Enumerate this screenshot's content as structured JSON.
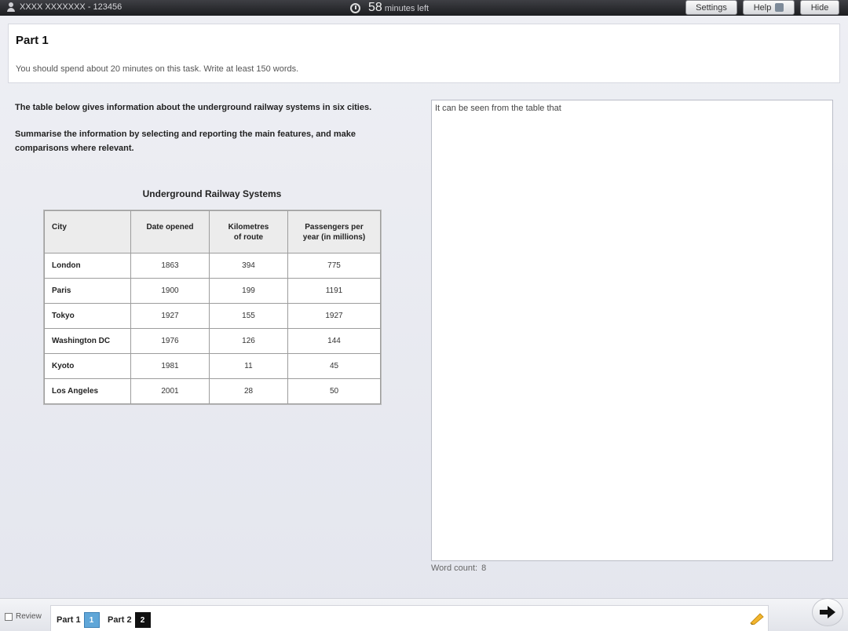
{
  "topbar": {
    "candidate": "XXXX XXXXXXX - 123456",
    "timer_value": "58",
    "timer_label": "minutes left",
    "settings_label": "Settings",
    "help_label": "Help",
    "hide_label": "Hide",
    "icons": [
      "user-icon",
      "alarm-clock-icon",
      "help-icon"
    ]
  },
  "header": {
    "part_title": "Part 1",
    "instructions": "You should spend about 20 minutes on this task. Write at least 150 words."
  },
  "task": {
    "prompt": "The table below gives information about the underground railway systems in six cities.",
    "directive": "Summarise the information by selecting and reporting the main features, and make comparisons where relevant."
  },
  "table": {
    "title": "Underground Railway Systems",
    "headers": [
      "City",
      "Date opened",
      "Kilometres of route",
      "Passengers per year (in millions)"
    ],
    "rows": [
      [
        "London",
        "1863",
        "394",
        "775"
      ],
      [
        "Paris",
        "1900",
        "199",
        "1191"
      ],
      [
        "Tokyo",
        "1927",
        "155",
        "1927"
      ],
      [
        "Washington DC",
        "1976",
        "126",
        "144"
      ],
      [
        "Kyoto",
        "1981",
        "11",
        "45"
      ],
      [
        "Los Angeles",
        "2001",
        "28",
        "50"
      ]
    ]
  },
  "answer": {
    "text": "It can be seen from the table that",
    "word_count_label": "Word count:",
    "word_count": "8"
  },
  "footer": {
    "review_label": "Review",
    "tabs": [
      {
        "label": "Part 1",
        "number": "1",
        "active": true
      },
      {
        "label": "Part 2",
        "number": "2",
        "active": false
      }
    ],
    "icons": [
      "flag-icon",
      "next-arrow-icon"
    ]
  },
  "colors": {
    "topbar": "#25262a",
    "active_tab": "#5fa6d8",
    "flag": "#f2b52e"
  }
}
